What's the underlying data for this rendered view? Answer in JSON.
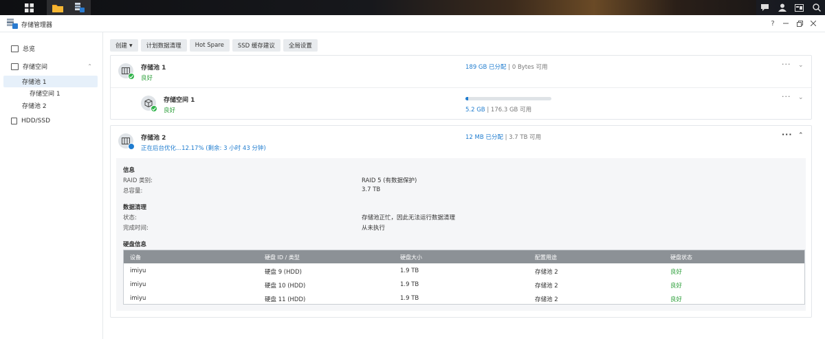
{
  "window": {
    "title": "存储管理器"
  },
  "sidebar": {
    "items": [
      {
        "label": "总览"
      },
      {
        "label": "存储空间"
      },
      {
        "label": "存储池 1"
      },
      {
        "label": "存储空间 1"
      },
      {
        "label": "存储池 2"
      },
      {
        "label": "HDD/SSD"
      }
    ]
  },
  "toolbar": {
    "create_label": "创建",
    "schedule_label": "计划数据清理",
    "hotspare_label": "Hot Spare",
    "ssd_label": "SSD 缓存建议",
    "global_label": "全局设置"
  },
  "pool1": {
    "name": "存储池 1",
    "status": "良好",
    "allocated": "189 GB 已分配",
    "available": "0 Bytes 可用"
  },
  "volume1": {
    "name": "存储空间 1",
    "status": "良好",
    "usage": "5.2 GB",
    "total": "176.3 GB 可用",
    "usage_fraction": 0.03
  },
  "pool2": {
    "name": "存储池 2",
    "status": "正在后台优化...12.17% (剩余: 3 小时 43 分钟)",
    "allocated": "12 MB 已分配",
    "available": "3.7 TB 可用",
    "info": {
      "title": "信息",
      "raid_key": "RAID 类别:",
      "raid_val": "RAID 5 (有数据保护)",
      "cap_key": "总容量:",
      "cap_val": "3.7 TB"
    },
    "scrub": {
      "title": "数据清理",
      "state_key": "状态:",
      "state_val": "存储池正忙，因此无法运行数据清理",
      "done_key": "完成时间:",
      "done_val": "从未执行"
    },
    "disks": {
      "title": "硬盘信息",
      "headers": [
        "设备",
        "硬盘 ID / 类型",
        "硬盘大小",
        "配置用途",
        "硬盘状态"
      ],
      "rows": [
        [
          "imiyu",
          "硬盘 9 (HDD)",
          "1.9 TB",
          "存储池 2",
          "良好"
        ],
        [
          "imiyu",
          "硬盘 10 (HDD)",
          "1.9 TB",
          "存储池 2",
          "良好"
        ],
        [
          "imiyu",
          "硬盘 11 (HDD)",
          "1.9 TB",
          "存储池 2",
          "良好"
        ]
      ]
    }
  },
  "colors": {
    "accent": "#1f7ccf",
    "ok": "#2fa03c"
  }
}
